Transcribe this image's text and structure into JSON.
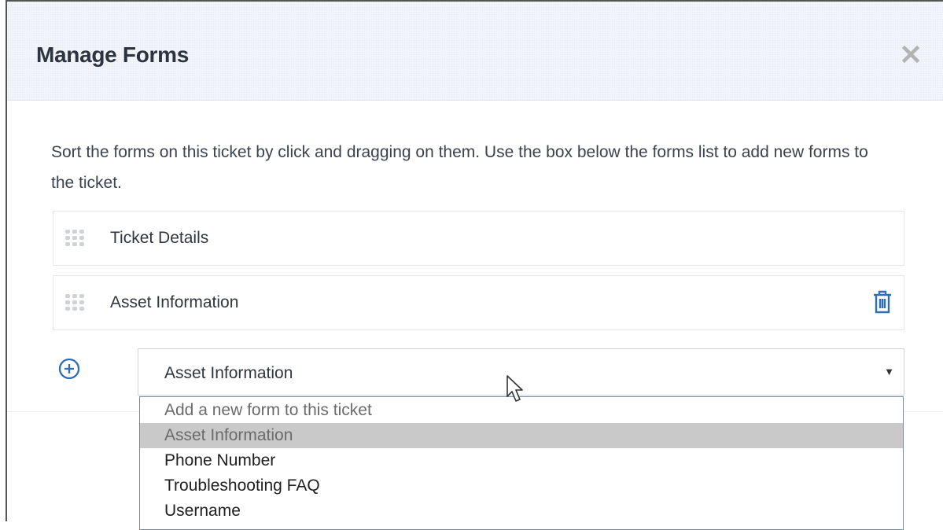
{
  "dialog": {
    "title": "Manage Forms",
    "close_icon": "close-icon"
  },
  "description": "Sort the forms on this ticket by click and dragging on them. Use the box below the forms list to add new forms to the ticket.",
  "forms": [
    {
      "label": "Ticket Details",
      "drag_icon": "drag-handle-icon",
      "deletable": false
    },
    {
      "label": "Asset Information",
      "drag_icon": "drag-handle-icon",
      "deletable": true,
      "delete_icon": "trash-icon"
    }
  ],
  "add_form": {
    "add_icon": "plus-circle-icon",
    "selected_value": "Asset Information",
    "arrow_icon": "caret-down-icon",
    "options": [
      "Add a new form to this ticket",
      "Asset Information",
      "Phone Number",
      "Troubleshooting FAQ",
      "Username"
    ],
    "highlighted_option": "Asset Information"
  },
  "colors": {
    "accent": "#2f6db5",
    "title": "#2b3440",
    "header_bg": "#f1f4f8",
    "highlight": "#c9c9c9"
  }
}
